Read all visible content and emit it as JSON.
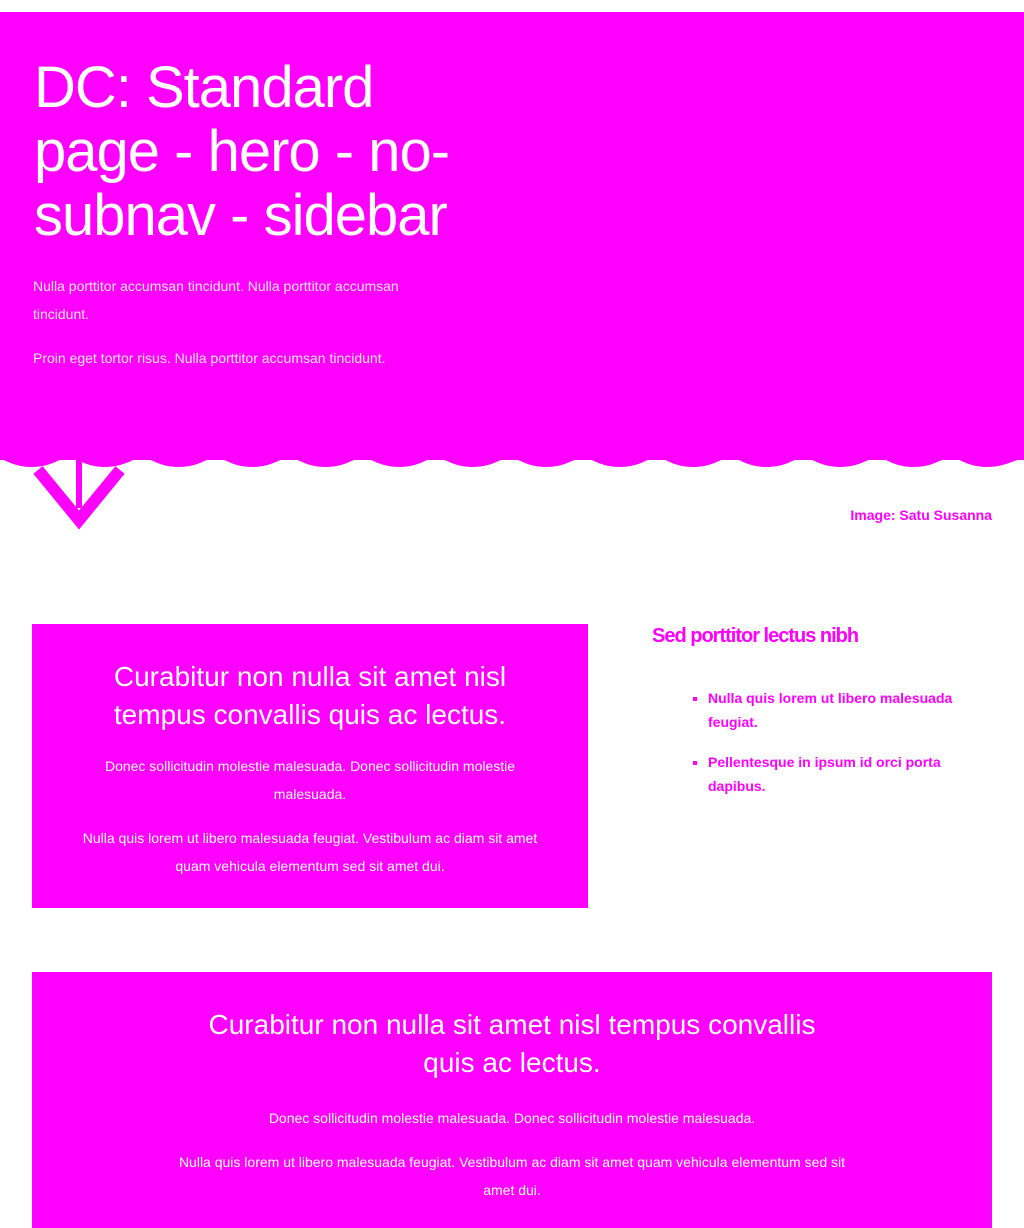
{
  "hero": {
    "title": "DC: Standard page - hero - no-subnav - sidebar",
    "paragraphs": [
      "Nulla porttitor accumsan tincidunt. Nulla porttitor accumsan tincidunt.",
      "Proin eget tortor risus. Nulla porttitor accumsan tincidunt."
    ],
    "image_credit": "Image: Satu Susanna",
    "color": "#ff00ff"
  },
  "card1": {
    "heading": "Curabitur non nulla sit amet nisl tempus convallis quis ac lectus.",
    "paragraphs": [
      "Donec sollicitudin molestie malesuada. Donec sollicitudin molestie malesuada.",
      "Nulla quis lorem ut libero malesuada feugiat. Vestibulum ac diam sit amet quam vehicula elementum sed sit amet dui."
    ]
  },
  "sidebar": {
    "heading": "Sed porttitor lectus nibh",
    "items": [
      "Nulla quis lorem ut libero malesuada feugiat.",
      "Pellentesque in ipsum id orci porta dapibus."
    ]
  },
  "card2": {
    "heading": "Curabitur non nulla sit amet nisl tempus convallis quis ac lectus.",
    "paragraphs": [
      "Donec sollicitudin molestie malesuada. Donec sollicitudin molestie malesuada.",
      "Nulla quis lorem ut libero malesuada feugiat. Vestibulum ac diam sit amet quam vehicula elementum sed sit amet dui."
    ]
  }
}
